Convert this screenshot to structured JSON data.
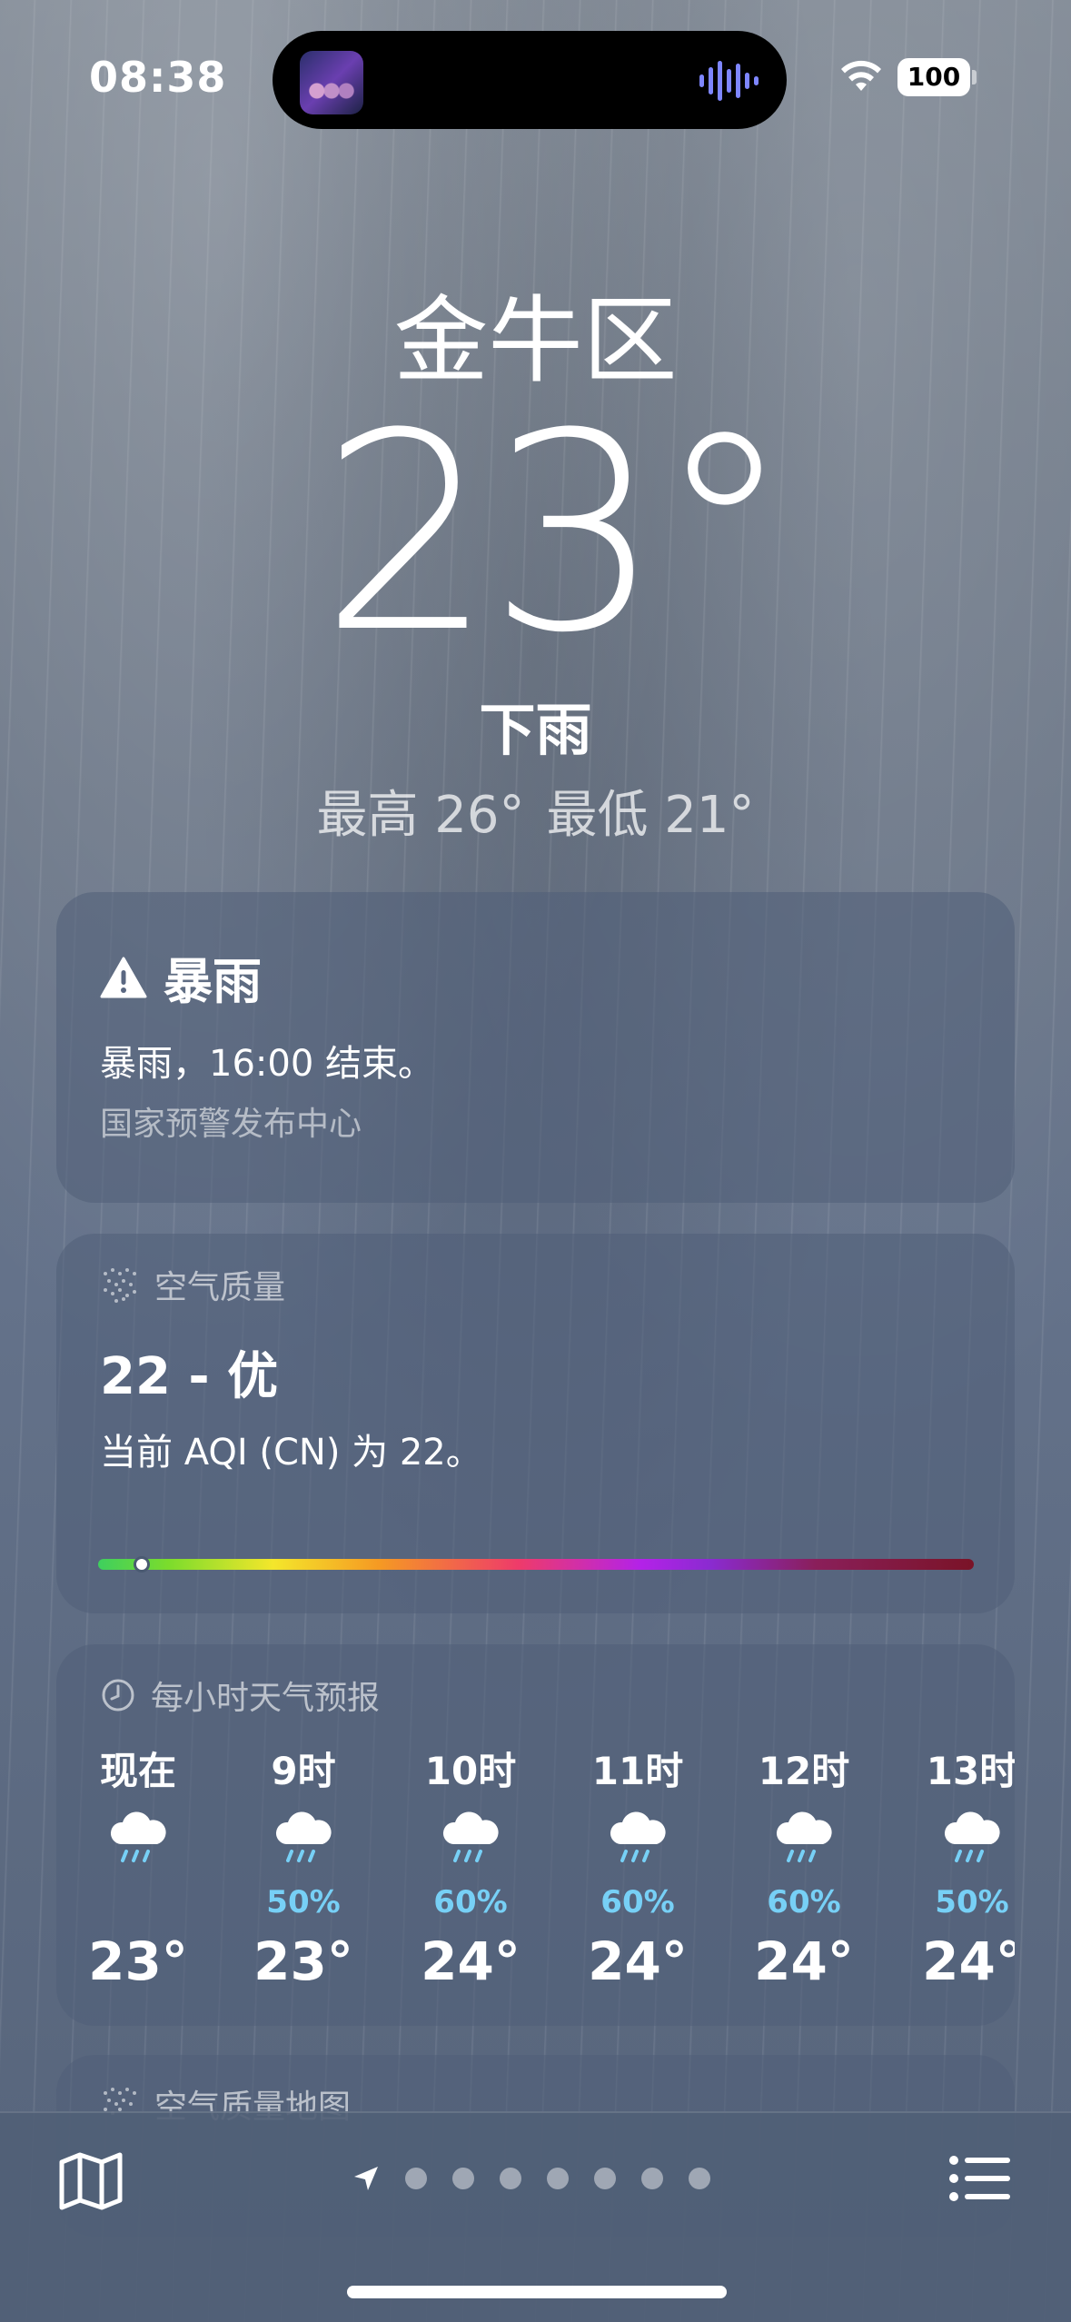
{
  "status_bar": {
    "time": "08:38",
    "battery": "100",
    "icons": [
      "album-art-icon",
      "waveform-icon",
      "wifi-icon",
      "battery-icon"
    ]
  },
  "hero": {
    "city": "金牛区",
    "temperature": "23°",
    "condition": "下雨",
    "high": "最高 26°",
    "low": "最低 21°"
  },
  "alert": {
    "icon": "warning-triangle-icon",
    "title": "暴雨",
    "body": "暴雨，16:00 结束。",
    "source": "国家预警发布中心"
  },
  "air_quality": {
    "icon": "air-quality-dots-icon",
    "header": "空气质量",
    "value": "22 - 优",
    "description": "当前 AQI (CN) 为 22。",
    "scale_position": 0.05,
    "scale_colors": [
      "#3ecf5e",
      "#f4e62b",
      "#f59a23",
      "#ee3b6a",
      "#b322e8",
      "#7a1327"
    ]
  },
  "hourly": {
    "icon": "clock-icon",
    "header": "每小时天气预报",
    "items": [
      {
        "label": "现在",
        "icon": "rain-cloud-icon",
        "pop": "",
        "temp": "23°"
      },
      {
        "label": "9时",
        "icon": "rain-cloud-icon",
        "pop": "50%",
        "temp": "23°"
      },
      {
        "label": "10时",
        "icon": "rain-cloud-icon",
        "pop": "60%",
        "temp": "24°"
      },
      {
        "label": "11时",
        "icon": "rain-cloud-icon",
        "pop": "60%",
        "temp": "24°"
      },
      {
        "label": "12时",
        "icon": "rain-cloud-icon",
        "pop": "60%",
        "temp": "24°"
      },
      {
        "label": "13时",
        "icon": "rain-cloud-icon",
        "pop": "50%",
        "temp": "24°"
      }
    ]
  },
  "air_quality_map": {
    "icon": "air-quality-dots-icon",
    "header": "空气质量地图"
  },
  "toolbar": {
    "map_icon": "map-icon",
    "location_icon": "location-arrow-icon",
    "page_count": 7,
    "list_icon": "list-icon"
  },
  "colors": {
    "pop_blue": "#77d0f6",
    "card_bg": "rgba(80,95,120,0.55)"
  }
}
